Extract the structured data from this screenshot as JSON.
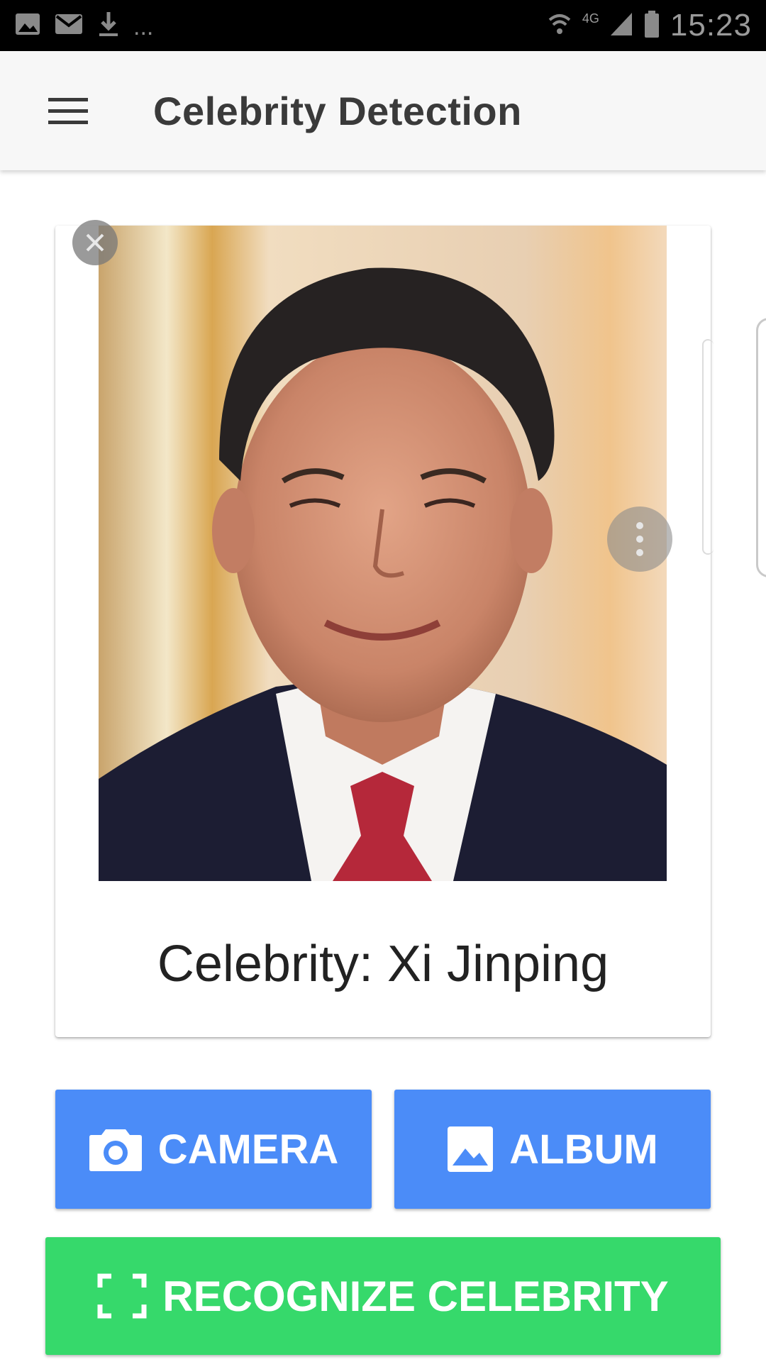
{
  "status_bar": {
    "time": "15:23",
    "network": "4G",
    "more": "...",
    "icons": [
      "image-icon",
      "mail-icon",
      "download-icon",
      "wifi-icon",
      "signal-icon",
      "battery-icon"
    ]
  },
  "app_bar": {
    "title": "Celebrity Detection",
    "menu_icon": "hamburger-menu-icon"
  },
  "card": {
    "celebrity_label": "Celebrity: Xi Jinping",
    "close_icon": "close-icon",
    "more_icon": "more-vert-icon"
  },
  "buttons": {
    "camera_label": "CAMERA",
    "camera_icon": "camera-icon",
    "album_label": "ALBUM",
    "album_icon": "image-icon",
    "recognize_label": "RECOGNIZE CELEBRITY",
    "recognize_icon": "scan-frame-icon"
  },
  "colors": {
    "primary_button": "#4b8cf8",
    "recognize_button": "#36d96b",
    "app_bar": "#f7f7f7",
    "status_bar": "#000000"
  }
}
